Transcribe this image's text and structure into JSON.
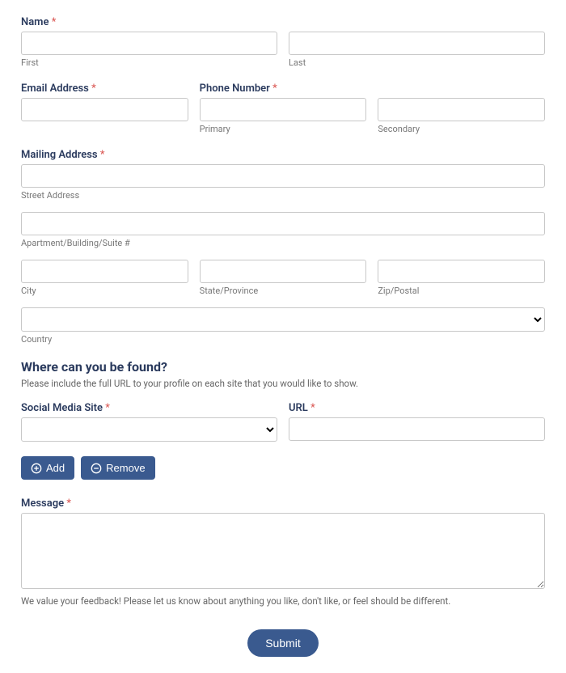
{
  "name": {
    "label": "Name",
    "first_sublabel": "First",
    "last_sublabel": "Last"
  },
  "email": {
    "label": "Email Address"
  },
  "phone": {
    "label": "Phone Number",
    "primary_sublabel": "Primary",
    "secondary_sublabel": "Secondary"
  },
  "address": {
    "label": "Mailing Address",
    "street_sublabel": "Street Address",
    "line2_sublabel": "Apartment/Building/Suite #",
    "city_sublabel": "City",
    "state_sublabel": "State/Province",
    "zip_sublabel": "Zip/Postal",
    "country_sublabel": "Country"
  },
  "social": {
    "heading": "Where can you be found?",
    "description": "Please include the full URL to your profile on each site that you would like to show.",
    "site_label": "Social Media Site",
    "url_label": "URL"
  },
  "buttons": {
    "add": "Add",
    "remove": "Remove",
    "submit": "Submit"
  },
  "message": {
    "label": "Message",
    "help": "We value your feedback! Please let us know about anything you like, don't like, or feel should be different."
  },
  "required_marker": "*"
}
